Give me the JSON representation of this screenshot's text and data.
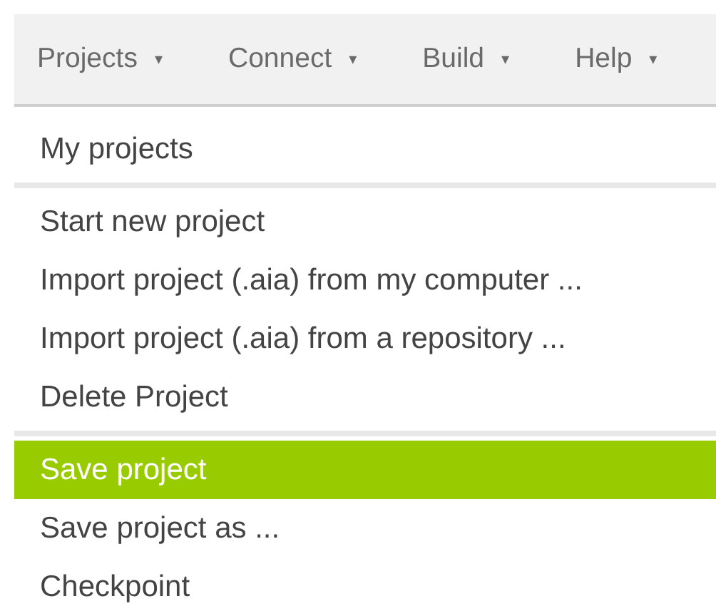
{
  "menu_bar": {
    "items": [
      {
        "label": "Projects",
        "caret": "▾"
      },
      {
        "label": "Connect",
        "caret": "▾"
      },
      {
        "label": "Build",
        "caret": "▾"
      },
      {
        "label": "Help",
        "caret": "▾"
      }
    ]
  },
  "dropdown": {
    "sections": [
      {
        "items": [
          {
            "label": "My projects",
            "selected": false
          }
        ]
      },
      {
        "items": [
          {
            "label": "Start new project",
            "selected": false
          },
          {
            "label": "Import project (.aia) from my computer ...",
            "selected": false
          },
          {
            "label": "Import project (.aia) from a repository ...",
            "selected": false
          },
          {
            "label": "Delete Project",
            "selected": false
          }
        ]
      },
      {
        "items": [
          {
            "label": "Save project",
            "selected": true
          },
          {
            "label": "Save project as ...",
            "selected": false
          },
          {
            "label": "Checkpoint",
            "selected": false
          }
        ]
      }
    ]
  }
}
